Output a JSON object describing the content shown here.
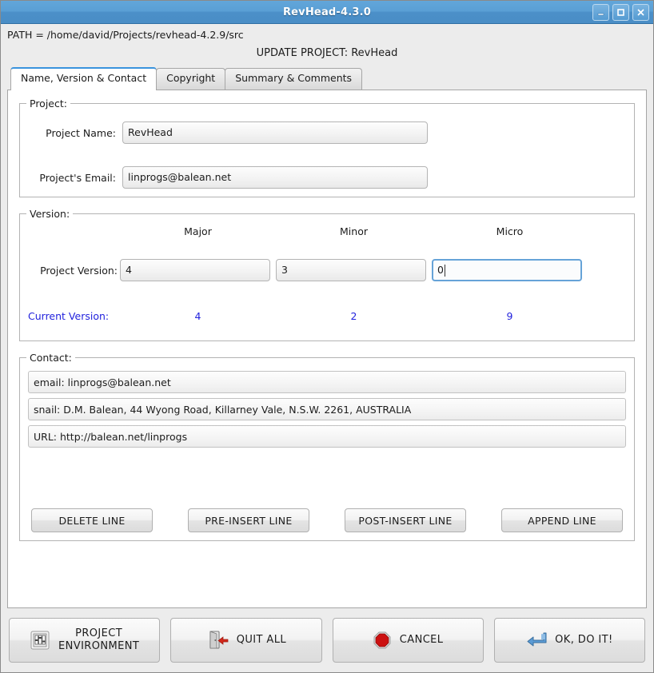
{
  "window": {
    "title": "RevHead-4.3.0",
    "controls": [
      {
        "name": "minimize-button",
        "glyph": "minimize"
      },
      {
        "name": "maximize-button",
        "glyph": "maximize"
      },
      {
        "name": "close-button",
        "glyph": "close"
      }
    ]
  },
  "header": {
    "path": "PATH = /home/david/Projects/revhead-4.2.9/src",
    "update_title": "UPDATE PROJECT: RevHead"
  },
  "tabs": [
    {
      "label": "Name, Version & Contact",
      "active": true
    },
    {
      "label": "Copyright",
      "active": false
    },
    {
      "label": "Summary & Comments",
      "active": false
    }
  ],
  "project_group": {
    "legend": "Project:",
    "name_label": "Project Name:",
    "name_value": "RevHead",
    "email_label": "Project's Email:",
    "email_value": "linprogs@balean.net"
  },
  "version_group": {
    "legend": "Version:",
    "columns": [
      "Major",
      "Minor",
      "Micro"
    ],
    "project_version_label": "Project Version:",
    "project_version": [
      "4",
      "3",
      "0"
    ],
    "focused_index": 2,
    "current_version_label": "Current Version:",
    "current_version": [
      "4",
      "2",
      "9"
    ],
    "current_version_color": "#2222dd"
  },
  "contact_group": {
    "legend": "Contact:",
    "lines": [
      "email: linprogs@balean.net",
      "snail: D.M. Balean, 44 Wyong Road, Killarney Vale, N.S.W. 2261, AUSTRALIA",
      "URL:  http://balean.net/linprogs"
    ],
    "line_buttons": [
      "DELETE LINE",
      "PRE-INSERT LINE",
      "POST-INSERT LINE",
      "APPEND LINE"
    ]
  },
  "bottom_buttons": [
    {
      "label_line1": "PROJECT",
      "label_line2": "ENVIRONMENT",
      "icon": "sliders-icon"
    },
    {
      "label_line1": "QUIT ALL",
      "label_line2": "",
      "icon": "exit-door-icon"
    },
    {
      "label_line1": "CANCEL",
      "label_line2": "",
      "icon": "stop-sign-icon"
    },
    {
      "label_line1": "OK, DO IT!",
      "label_line2": "",
      "icon": "enter-arrow-icon"
    }
  ],
  "colors": {
    "titlebar": "#5a9fd5",
    "accent": "#3a93dd",
    "focus_border": "#66a3d8",
    "stop_red": "#cc1111",
    "window_bg": "#ececec"
  }
}
